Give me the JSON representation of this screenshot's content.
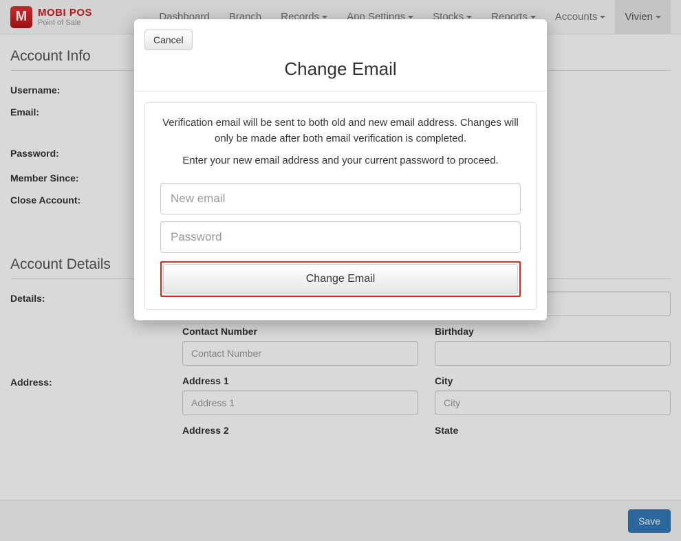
{
  "brand": {
    "logo_letter": "M",
    "title": "MOBI POS",
    "subtitle": "Point of Sale"
  },
  "nav": {
    "dashboard": "Dashboard",
    "branch": "Branch",
    "records": "Records",
    "app_settings": "App Settings",
    "stocks": "Stocks",
    "reports": "Reports",
    "accounts": "Accounts",
    "user": "Vivien"
  },
  "sections": {
    "account_info": "Account Info",
    "account_details": "Account Details"
  },
  "labels": {
    "username": "Username:",
    "email": "Email:",
    "password": "Password:",
    "member_since": "Member Since:",
    "close_account": "Close Account:",
    "details": "Details:",
    "address": "Address:"
  },
  "fields": {
    "contact_number": {
      "label": "Contact Number",
      "placeholder": "Contact Number"
    },
    "birthday": {
      "label": "Birthday"
    },
    "address1": {
      "label": "Address 1",
      "placeholder": "Address 1"
    },
    "city": {
      "label": "City",
      "placeholder": "City"
    },
    "address2": {
      "label": "Address 2"
    },
    "state": {
      "label": "State"
    }
  },
  "footer": {
    "save": "Save"
  },
  "modal": {
    "cancel": "Cancel",
    "title": "Change Email",
    "msg1": "Verification email will be sent to both old and new email address. Changes will only be made after both email verification is completed.",
    "msg2": "Enter your new email address and your current password to proceed.",
    "new_email_placeholder": "New email",
    "password_placeholder": "Password",
    "submit": "Change Email"
  }
}
